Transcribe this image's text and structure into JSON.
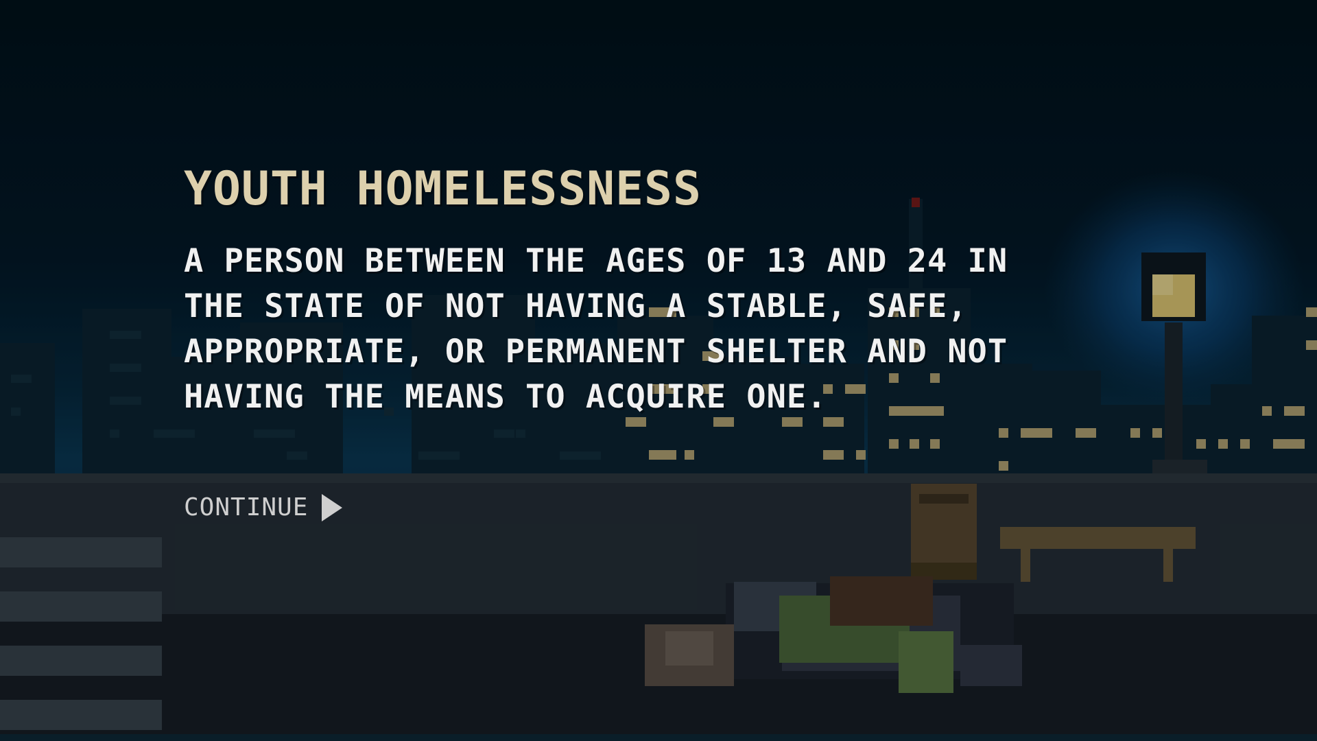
{
  "screen": {
    "title": "YOUTH HOMELESSNESS",
    "definition_lines": [
      "A PERSON BETWEEN THE AGES OF 13 AND 24 IN",
      "THE STATE OF NOT HAVING A STABLE, SAFE,",
      "APPROPRIATE, OR PERMANENT SHELTER AND NOT",
      "HAVING THE MEANS TO ACQUIRE ONE."
    ],
    "continue_label": "CONTINUE",
    "continue_icon": "play-arrow-icon"
  },
  "colors": {
    "sky_top": "#01121c",
    "title": "#ddd0ad",
    "body_text": "#f1f1f1",
    "lamp_light": "#e6cf78",
    "window_light": "#d9c78a"
  }
}
